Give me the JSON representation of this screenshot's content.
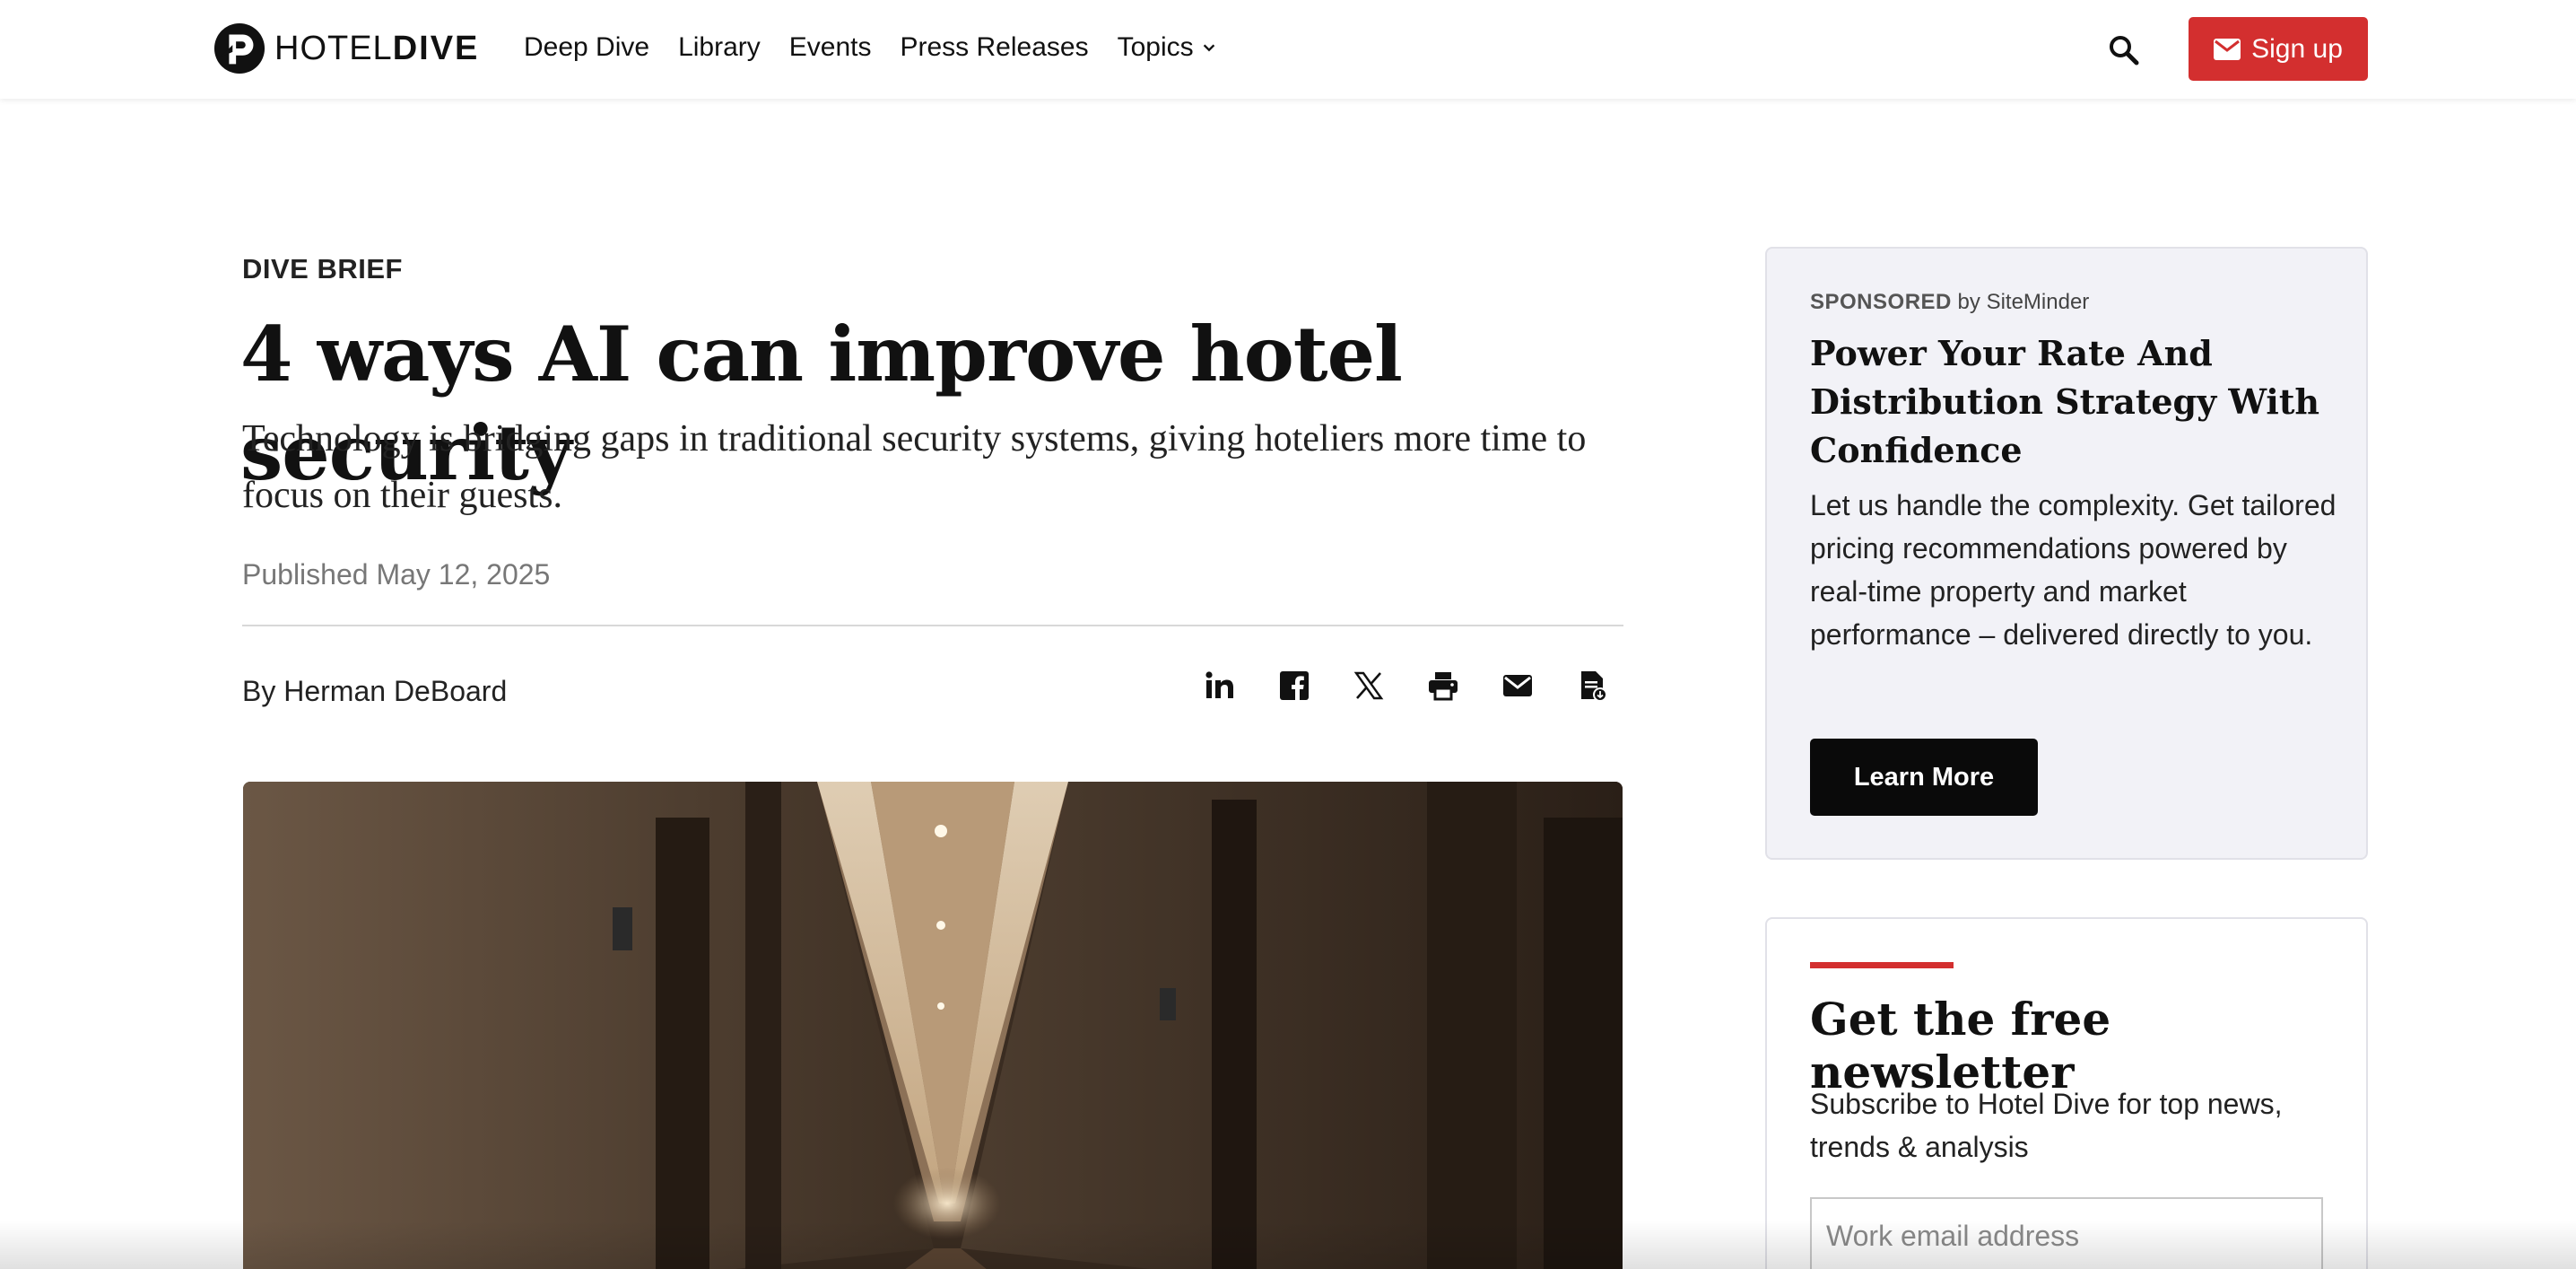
{
  "brand": {
    "name_light": "HOTEL",
    "name_bold": "DIVE"
  },
  "nav": {
    "items": [
      {
        "label": "Deep Dive"
      },
      {
        "label": "Library"
      },
      {
        "label": "Events"
      },
      {
        "label": "Press Releases"
      },
      {
        "label": "Topics"
      }
    ]
  },
  "header": {
    "signup_label": "Sign up"
  },
  "article": {
    "kicker": "DIVE BRIEF",
    "headline": "4 ways AI can improve hotel security",
    "dek": "Technology is bridging gaps in traditional security systems, giving hoteliers more time to focus on their guests.",
    "published": "Published May 12, 2025",
    "byline": "By Herman DeBoard",
    "share_icons": [
      "linkedin-icon",
      "facebook-icon",
      "x-icon",
      "print-icon",
      "email-icon",
      "document-icon"
    ]
  },
  "sponsored": {
    "label": "SPONSORED",
    "by": "by SiteMinder",
    "title": "Power Your Rate And Distribution Strategy With Confidence",
    "body": "Let us handle the complexity. Get tailored pricing recommendations powered by real-time property and market performance – delivered directly to you.",
    "button": "Learn More"
  },
  "newsletter": {
    "title": "Get the free newsletter",
    "body": "Subscribe to Hotel Dive for top news, trends & analysis",
    "email_placeholder": "Work email address"
  },
  "colors": {
    "accent": "#d32f2f",
    "sponsored_bg": "#f2f2f7",
    "button_dark": "#0a0a0a"
  }
}
